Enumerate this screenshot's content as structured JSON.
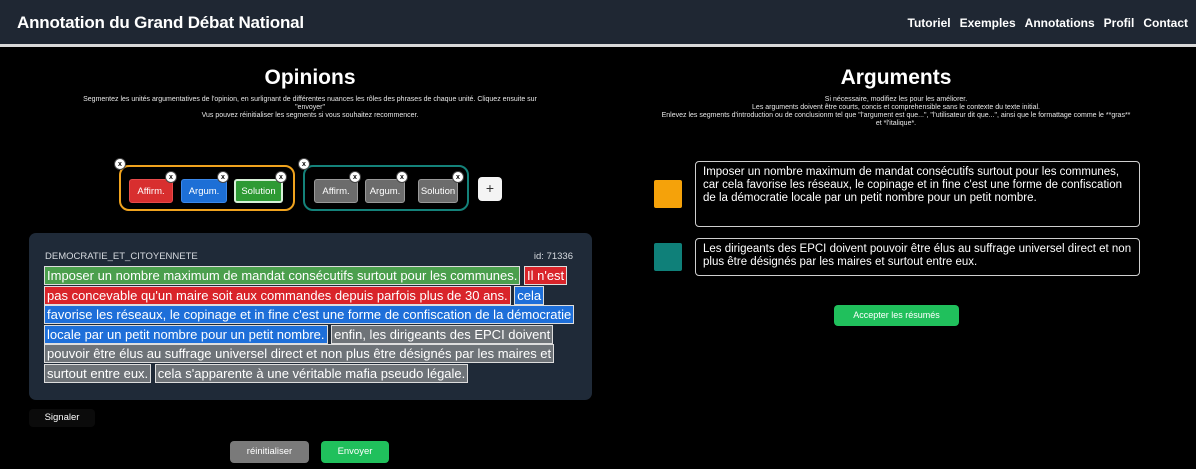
{
  "brand": "Annotation du Grand Débat National",
  "nav": [
    "Tutoriel",
    "Exemples",
    "Annotations",
    "Profil",
    "Contact"
  ],
  "colors": {
    "navbar_bg": "#1f2733",
    "affirmation": "#d82f2f",
    "argument": "#1d6fd6",
    "solution": "#2e9a34",
    "inactive": "#6c6c6c",
    "group1_border": "#f0a31e",
    "group2_border": "#14827a",
    "accept_green": "#20c05c"
  },
  "opinions": {
    "title": "Opinions",
    "desc1": "Segmentez les unités argumentatives de l'opinion, en surlignant de différentes nuances les rôles des phrases de chaque unité. Cliquez ensuite sur",
    "desc2": "\"envoyer\"",
    "desc3": "Vus pouvez réinitialiser les segments si vous souhaitez recommencer."
  },
  "groups": [
    {
      "chips": [
        "Affirm.",
        "Argum.",
        "Solution"
      ],
      "close": "x",
      "chip_close": [
        "x",
        "x",
        "x"
      ]
    },
    {
      "chips": [
        "Affirm.",
        "Argum.",
        "Solution"
      ],
      "close": "x",
      "chip_close": [
        "x",
        "x",
        "x"
      ]
    }
  ],
  "add_label": "+",
  "card": {
    "category": "DEMOCRATIE_ET_CITOYENNETE",
    "id": "id: 71336",
    "segments": [
      "Imposer un nombre maximum de mandat consécutifs surtout pour les communes.",
      "Il n'est pas concevable qu'un maire soit aux commandes depuis parfois plus de 30 ans.",
      "cela favorise les réseaux, le copinage et in fine c'est une forme de confiscation de la démocratie locale par un petit nombre pour un petit nombre.",
      "enfin, les dirigeants des EPCI doivent pouvoir être élus au suffrage universel direct et non plus être désignés par les maires et surtout entre eux.",
      "cela s'apparente à une véritable mafia pseudo légale."
    ]
  },
  "buttons": {
    "signal": "Signaler",
    "reset": "réinitialiser",
    "send": "Envoyer",
    "accept": "Accepter les résumés"
  },
  "arguments": {
    "title": "Arguments",
    "desc1": "Si nécessaire, modifiez les pour les améliorer.",
    "desc2": "Les arguments doivent être courts, concis et comprehensible sans le contexte du texte initial.",
    "desc3": "Enlevez les segments d'introduction ou de conclusionm tel que \"l'argument est que...\", \"l'utilisateur dit que...\", ainsi que le formattage comme le **gras**",
    "desc4": "et *l'italique*.",
    "items": [
      {
        "color": "#f5a20a",
        "text": "Imposer un nombre maximum de mandat consécutifs surtout pour les communes, car cela favorise les réseaux, le copinage et in fine c'est une forme de confiscation de la démocratie locale par un petit nombre pour un petit nombre."
      },
      {
        "color": "#0f8079",
        "text": "Les dirigeants des EPCI doivent pouvoir être élus au suffrage universel direct et non plus être désignés par les maires et surtout entre eux."
      }
    ]
  }
}
